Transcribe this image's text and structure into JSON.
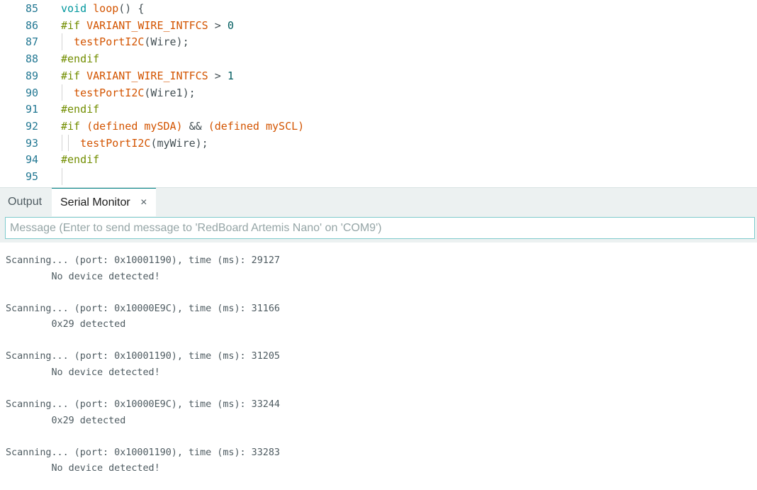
{
  "editor": {
    "lines": [
      {
        "no": "85",
        "tokens": [
          {
            "t": "void",
            "c": "kw"
          },
          {
            "t": " ",
            "c": "op"
          },
          {
            "t": "loop",
            "c": "fn"
          },
          {
            "t": "() {",
            "c": "op"
          }
        ]
      },
      {
        "no": "86",
        "tokens": [
          {
            "t": "#if ",
            "c": "pp"
          },
          {
            "t": "VARIANT_WIRE_INTFCS",
            "c": "fn"
          },
          {
            "t": " > ",
            "c": "op"
          },
          {
            "t": "0",
            "c": "num"
          }
        ]
      },
      {
        "no": "87",
        "tokens": [
          {
            "t": "  ",
            "c": "op"
          },
          {
            "t": "testPortI2C",
            "c": "fn"
          },
          {
            "t": "(Wire);",
            "c": "op"
          }
        ]
      },
      {
        "no": "88",
        "tokens": [
          {
            "t": "#endif",
            "c": "pp"
          }
        ]
      },
      {
        "no": "89",
        "tokens": [
          {
            "t": "#if ",
            "c": "pp"
          },
          {
            "t": "VARIANT_WIRE_INTFCS",
            "c": "fn"
          },
          {
            "t": " > ",
            "c": "op"
          },
          {
            "t": "1",
            "c": "num"
          }
        ]
      },
      {
        "no": "90",
        "tokens": [
          {
            "t": "  ",
            "c": "op"
          },
          {
            "t": "testPortI2C",
            "c": "fn"
          },
          {
            "t": "(Wire1);",
            "c": "op"
          }
        ]
      },
      {
        "no": "91",
        "tokens": [
          {
            "t": "#endif",
            "c": "pp"
          }
        ]
      },
      {
        "no": "92",
        "tokens": [
          {
            "t": "#if ",
            "c": "pp"
          },
          {
            "t": "(defined mySDA)",
            "c": "fn"
          },
          {
            "t": " && ",
            "c": "op"
          },
          {
            "t": "(defined mySCL)",
            "c": "fn"
          }
        ]
      },
      {
        "no": "93",
        "tokens": [
          {
            "t": "   ",
            "c": "op"
          },
          {
            "t": "testPortI2C",
            "c": "fn"
          },
          {
            "t": "(myWire);",
            "c": "op"
          }
        ]
      },
      {
        "no": "94",
        "tokens": [
          {
            "t": "#endif",
            "c": "pp"
          }
        ]
      },
      {
        "no": "95",
        "tokens": []
      }
    ]
  },
  "panel": {
    "tabs": [
      {
        "label": "Output"
      },
      {
        "label": "Serial Monitor",
        "close": "×"
      }
    ],
    "message_placeholder": "Message (Enter to send message to 'RedBoard Artemis Nano' on 'COM9')",
    "console_lines": [
      "Scanning... (port: 0x10001190), time (ms): 29127",
      "        No device detected!",
      "",
      "Scanning... (port: 0x10000E9C), time (ms): 31166",
      "        0x29 detected",
      "",
      "Scanning... (port: 0x10001190), time (ms): 31205",
      "        No device detected!",
      "",
      "Scanning... (port: 0x10000E9C), time (ms): 33244",
      "        0x29 detected",
      "",
      "Scanning... (port: 0x10001190), time (ms): 33283",
      "        No device detected!"
    ]
  },
  "colors": {
    "line_number": "#237893",
    "keyword": "#00979d",
    "function": "#d35400",
    "preprocessor": "#728e00",
    "panel_bg": "#ecf1f1",
    "input_border": "#7fcbcd"
  }
}
